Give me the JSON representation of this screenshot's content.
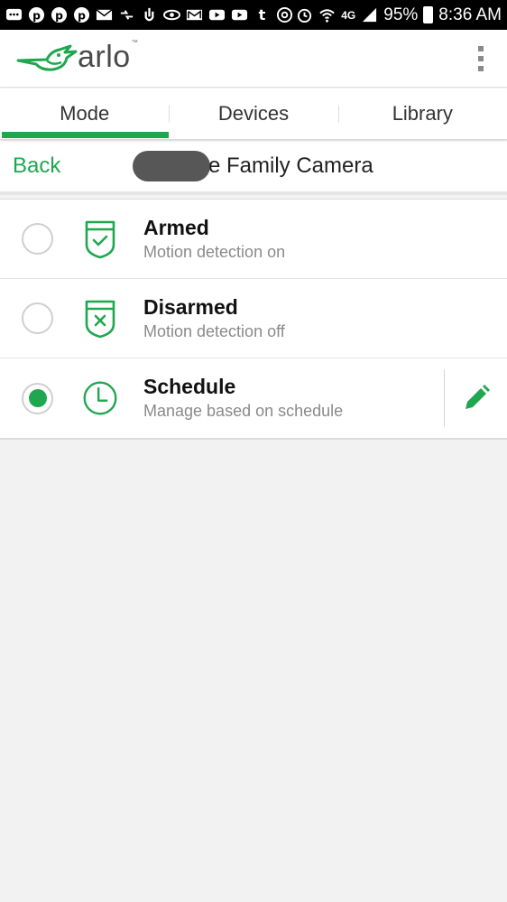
{
  "status_bar": {
    "battery": "95%",
    "time": "8:36 AM",
    "network": "4G"
  },
  "app": {
    "logo_text": "arlo",
    "trademark": "™",
    "brand_color": "#1fa74f"
  },
  "tabs": [
    {
      "label": "Mode",
      "active": true
    },
    {
      "label": "Devices",
      "active": false
    },
    {
      "label": "Library",
      "active": false
    }
  ],
  "sub_header": {
    "back_label": "Back",
    "camera_name": "e Family Camera"
  },
  "modes": [
    {
      "title": "Armed",
      "subtitle": "Motion detection on",
      "selected": false,
      "icon": "shield-check-icon"
    },
    {
      "title": "Disarmed",
      "subtitle": "Motion detection off",
      "selected": false,
      "icon": "shield-x-icon"
    },
    {
      "title": "Schedule",
      "subtitle": "Manage based on schedule",
      "selected": true,
      "icon": "clock-icon",
      "editable": true
    }
  ]
}
